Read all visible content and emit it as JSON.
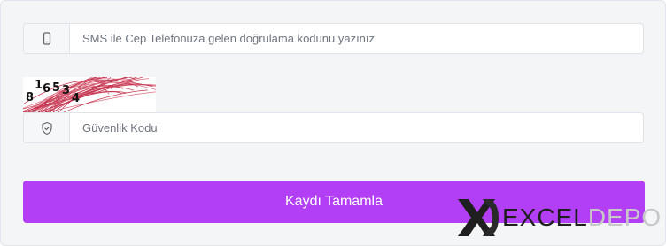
{
  "phone": {
    "placeholder": "SMS ile Cep Telefonuza gelen doğrulama kodunu yazınız",
    "icon": "mobile-phone-icon"
  },
  "captcha": {
    "digits": [
      "8",
      "1",
      "6",
      "5",
      "3",
      "4"
    ]
  },
  "security": {
    "placeholder": "Güvenlik Kodu",
    "icon": "shield-check-icon"
  },
  "submit": {
    "label": "Kaydı Tamamla",
    "color": "#b23ef5"
  },
  "logo": {
    "part1": "EXCEL",
    "part2": "DEPO",
    "mark_color": "#1f1f1f",
    "accent_color": "#c7c7c7"
  }
}
